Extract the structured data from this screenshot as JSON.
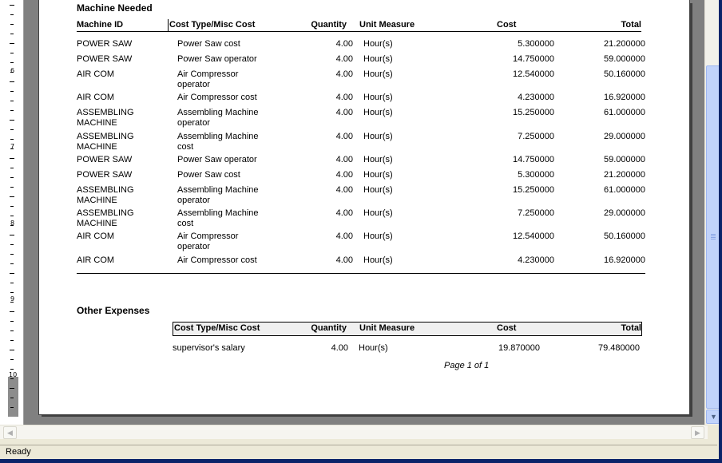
{
  "ruler": {
    "numbers": [
      "6",
      "7",
      "8",
      "9",
      "10"
    ]
  },
  "machine_section": {
    "title": "Machine Needed",
    "columns": {
      "machine_id": "Machine ID",
      "cost_type": "Cost Type/Misc Cost",
      "quantity": "Quantity",
      "unit": "Unit Measure",
      "cost": "Cost",
      "total": "Total"
    },
    "rows": [
      {
        "machine": "POWER SAW",
        "cost_type": "Power Saw cost",
        "qty": "4.00",
        "unit": "Hour(s)",
        "cost": "5.300000",
        "total": "21.200000"
      },
      {
        "machine": "POWER SAW",
        "cost_type": "Power Saw operator",
        "qty": "4.00",
        "unit": "Hour(s)",
        "cost": "14.750000",
        "total": "59.000000"
      },
      {
        "machine": "AIR COM",
        "cost_type": "Air Compressor operator",
        "qty": "4.00",
        "unit": "Hour(s)",
        "cost": "12.540000",
        "total": "50.160000"
      },
      {
        "machine": "AIR COM",
        "cost_type": "Air Compressor cost",
        "qty": "4.00",
        "unit": "Hour(s)",
        "cost": "4.230000",
        "total": "16.920000"
      },
      {
        "machine": "ASSEMBLING MACHINE",
        "cost_type": "Assembling Machine operator",
        "qty": "4.00",
        "unit": "Hour(s)",
        "cost": "15.250000",
        "total": "61.000000"
      },
      {
        "machine": "ASSEMBLING MACHINE",
        "cost_type": "Assembling Machine cost",
        "qty": "4.00",
        "unit": "Hour(s)",
        "cost": "7.250000",
        "total": "29.000000"
      },
      {
        "machine": "POWER SAW",
        "cost_type": "Power Saw operator",
        "qty": "4.00",
        "unit": "Hour(s)",
        "cost": "14.750000",
        "total": "59.000000"
      },
      {
        "machine": "POWER SAW",
        "cost_type": "Power Saw cost",
        "qty": "4.00",
        "unit": "Hour(s)",
        "cost": "5.300000",
        "total": "21.200000"
      },
      {
        "machine": "ASSEMBLING MACHINE",
        "cost_type": "Assembling Machine operator",
        "qty": "4.00",
        "unit": "Hour(s)",
        "cost": "15.250000",
        "total": "61.000000"
      },
      {
        "machine": "ASSEMBLING MACHINE",
        "cost_type": "Assembling Machine cost",
        "qty": "4.00",
        "unit": "Hour(s)",
        "cost": "7.250000",
        "total": "29.000000"
      },
      {
        "machine": "AIR COM",
        "cost_type": "Air Compressor operator",
        "qty": "4.00",
        "unit": "Hour(s)",
        "cost": "12.540000",
        "total": "50.160000"
      },
      {
        "machine": "AIR COM",
        "cost_type": "Air Compressor cost",
        "qty": "4.00",
        "unit": "Hour(s)",
        "cost": "4.230000",
        "total": "16.920000"
      }
    ]
  },
  "other_section": {
    "title": "Other Expenses",
    "columns": {
      "cost_type": "Cost Type/Misc Cost",
      "quantity": "Quantity",
      "unit": "Unit Measure",
      "cost": "Cost",
      "total": "Total"
    },
    "rows": [
      {
        "cost_type": "supervisor's salary",
        "qty": "4.00",
        "unit": "Hour(s)",
        "cost": "19.870000",
        "total": "79.480000"
      }
    ]
  },
  "page_number": "Page 1 of 1",
  "status": {
    "text": "Ready"
  },
  "scrollbar": {
    "down_arrow": "▼",
    "left_arrow": "◀",
    "right_arrow": "▶"
  }
}
